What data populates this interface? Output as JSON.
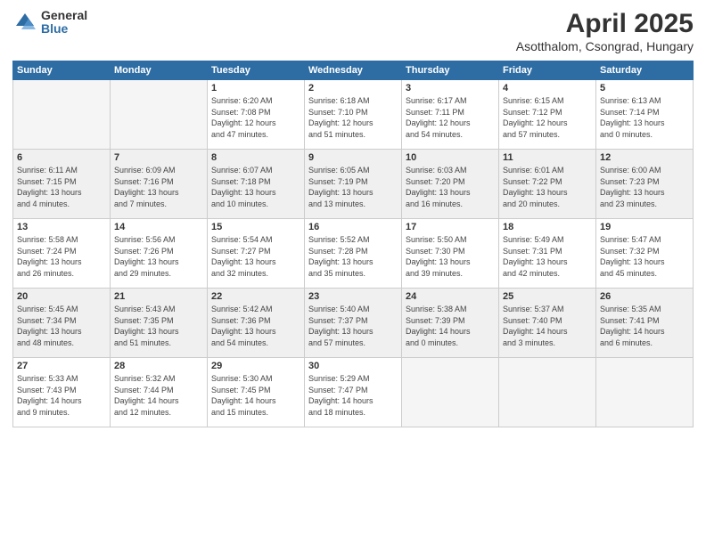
{
  "logo": {
    "general": "General",
    "blue": "Blue"
  },
  "header": {
    "title": "April 2025",
    "subtitle": "Asotthalom, Csongrad, Hungary"
  },
  "weekdays": [
    "Sunday",
    "Monday",
    "Tuesday",
    "Wednesday",
    "Thursday",
    "Friday",
    "Saturday"
  ],
  "weeks": [
    [
      {
        "day": "",
        "info": ""
      },
      {
        "day": "",
        "info": ""
      },
      {
        "day": "1",
        "info": "Sunrise: 6:20 AM\nSunset: 7:08 PM\nDaylight: 12 hours\nand 47 minutes."
      },
      {
        "day": "2",
        "info": "Sunrise: 6:18 AM\nSunset: 7:10 PM\nDaylight: 12 hours\nand 51 minutes."
      },
      {
        "day": "3",
        "info": "Sunrise: 6:17 AM\nSunset: 7:11 PM\nDaylight: 12 hours\nand 54 minutes."
      },
      {
        "day": "4",
        "info": "Sunrise: 6:15 AM\nSunset: 7:12 PM\nDaylight: 12 hours\nand 57 minutes."
      },
      {
        "day": "5",
        "info": "Sunrise: 6:13 AM\nSunset: 7:14 PM\nDaylight: 13 hours\nand 0 minutes."
      }
    ],
    [
      {
        "day": "6",
        "info": "Sunrise: 6:11 AM\nSunset: 7:15 PM\nDaylight: 13 hours\nand 4 minutes."
      },
      {
        "day": "7",
        "info": "Sunrise: 6:09 AM\nSunset: 7:16 PM\nDaylight: 13 hours\nand 7 minutes."
      },
      {
        "day": "8",
        "info": "Sunrise: 6:07 AM\nSunset: 7:18 PM\nDaylight: 13 hours\nand 10 minutes."
      },
      {
        "day": "9",
        "info": "Sunrise: 6:05 AM\nSunset: 7:19 PM\nDaylight: 13 hours\nand 13 minutes."
      },
      {
        "day": "10",
        "info": "Sunrise: 6:03 AM\nSunset: 7:20 PM\nDaylight: 13 hours\nand 16 minutes."
      },
      {
        "day": "11",
        "info": "Sunrise: 6:01 AM\nSunset: 7:22 PM\nDaylight: 13 hours\nand 20 minutes."
      },
      {
        "day": "12",
        "info": "Sunrise: 6:00 AM\nSunset: 7:23 PM\nDaylight: 13 hours\nand 23 minutes."
      }
    ],
    [
      {
        "day": "13",
        "info": "Sunrise: 5:58 AM\nSunset: 7:24 PM\nDaylight: 13 hours\nand 26 minutes."
      },
      {
        "day": "14",
        "info": "Sunrise: 5:56 AM\nSunset: 7:26 PM\nDaylight: 13 hours\nand 29 minutes."
      },
      {
        "day": "15",
        "info": "Sunrise: 5:54 AM\nSunset: 7:27 PM\nDaylight: 13 hours\nand 32 minutes."
      },
      {
        "day": "16",
        "info": "Sunrise: 5:52 AM\nSunset: 7:28 PM\nDaylight: 13 hours\nand 35 minutes."
      },
      {
        "day": "17",
        "info": "Sunrise: 5:50 AM\nSunset: 7:30 PM\nDaylight: 13 hours\nand 39 minutes."
      },
      {
        "day": "18",
        "info": "Sunrise: 5:49 AM\nSunset: 7:31 PM\nDaylight: 13 hours\nand 42 minutes."
      },
      {
        "day": "19",
        "info": "Sunrise: 5:47 AM\nSunset: 7:32 PM\nDaylight: 13 hours\nand 45 minutes."
      }
    ],
    [
      {
        "day": "20",
        "info": "Sunrise: 5:45 AM\nSunset: 7:34 PM\nDaylight: 13 hours\nand 48 minutes."
      },
      {
        "day": "21",
        "info": "Sunrise: 5:43 AM\nSunset: 7:35 PM\nDaylight: 13 hours\nand 51 minutes."
      },
      {
        "day": "22",
        "info": "Sunrise: 5:42 AM\nSunset: 7:36 PM\nDaylight: 13 hours\nand 54 minutes."
      },
      {
        "day": "23",
        "info": "Sunrise: 5:40 AM\nSunset: 7:37 PM\nDaylight: 13 hours\nand 57 minutes."
      },
      {
        "day": "24",
        "info": "Sunrise: 5:38 AM\nSunset: 7:39 PM\nDaylight: 14 hours\nand 0 minutes."
      },
      {
        "day": "25",
        "info": "Sunrise: 5:37 AM\nSunset: 7:40 PM\nDaylight: 14 hours\nand 3 minutes."
      },
      {
        "day": "26",
        "info": "Sunrise: 5:35 AM\nSunset: 7:41 PM\nDaylight: 14 hours\nand 6 minutes."
      }
    ],
    [
      {
        "day": "27",
        "info": "Sunrise: 5:33 AM\nSunset: 7:43 PM\nDaylight: 14 hours\nand 9 minutes."
      },
      {
        "day": "28",
        "info": "Sunrise: 5:32 AM\nSunset: 7:44 PM\nDaylight: 14 hours\nand 12 minutes."
      },
      {
        "day": "29",
        "info": "Sunrise: 5:30 AM\nSunset: 7:45 PM\nDaylight: 14 hours\nand 15 minutes."
      },
      {
        "day": "30",
        "info": "Sunrise: 5:29 AM\nSunset: 7:47 PM\nDaylight: 14 hours\nand 18 minutes."
      },
      {
        "day": "",
        "info": ""
      },
      {
        "day": "",
        "info": ""
      },
      {
        "day": "",
        "info": ""
      }
    ]
  ]
}
